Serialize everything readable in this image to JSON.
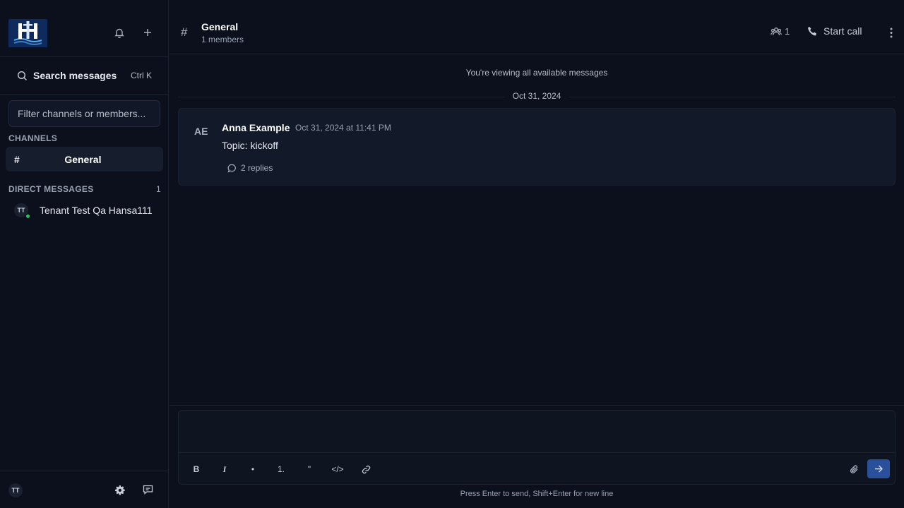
{
  "sidebar": {
    "search_label": "Search messages",
    "search_shortcut": "Ctrl K",
    "filter_placeholder": "Filter channels or members...",
    "channels_heading": "CHANNELS",
    "channels": [
      {
        "prefix": "#",
        "name": "General"
      }
    ],
    "dm_heading": "DIRECT MESSAGES",
    "dm_count": "1",
    "dms": [
      {
        "initials": "TT",
        "name": "Tenant Test Qa Hansa111",
        "online": true
      }
    ],
    "me_initials": "TT"
  },
  "header": {
    "hash": "#",
    "title": "General",
    "subtitle": "1 members",
    "members_count": "1",
    "call_label": "Start call"
  },
  "messages_area": {
    "viewing_notice": "You're viewing all available messages",
    "date_separator": "Oct 31, 2024",
    "messages": [
      {
        "avatar": "AE",
        "author": "Anna Example",
        "time": "Oct 31, 2024 at 11:41 PM",
        "text": "Topic: kickoff",
        "replies": "2 replies"
      }
    ]
  },
  "composer": {
    "toolbar": {
      "bold": "B",
      "italic": "I",
      "bullet": "•",
      "numbered": "1.",
      "quote": "\"",
      "code": "</>"
    },
    "hint": "Press Enter to send, Shift+Enter for new line"
  },
  "colors": {
    "background": "#0b101c",
    "accent": "#2a4f9b",
    "online": "#22c55e"
  }
}
